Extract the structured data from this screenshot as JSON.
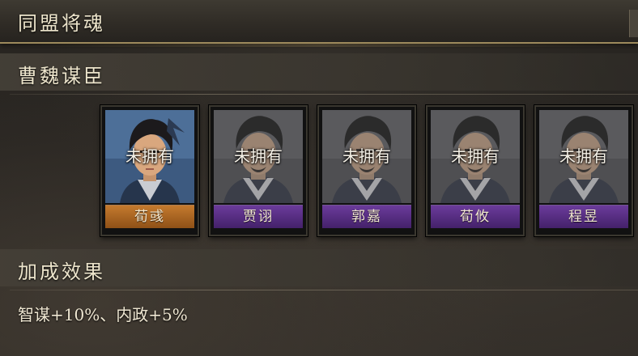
{
  "window": {
    "title": "同盟将魂"
  },
  "group": {
    "title": "曹魏谋臣"
  },
  "cards": [
    {
      "name": "荀彧",
      "status": "未拥有",
      "name_color": "#b06a25"
    },
    {
      "name": "贾诩",
      "status": "未拥有",
      "name_color": "#5a2f86"
    },
    {
      "name": "郭嘉",
      "status": "未拥有",
      "name_color": "#5a2f86"
    },
    {
      "name": "荀攸",
      "status": "未拥有",
      "name_color": "#5a2f86"
    },
    {
      "name": "程昱",
      "status": "未拥有",
      "name_color": "#5a2f86"
    }
  ],
  "bonus": {
    "title": "加成效果",
    "text": "智谋+10%、内政+5%"
  }
}
